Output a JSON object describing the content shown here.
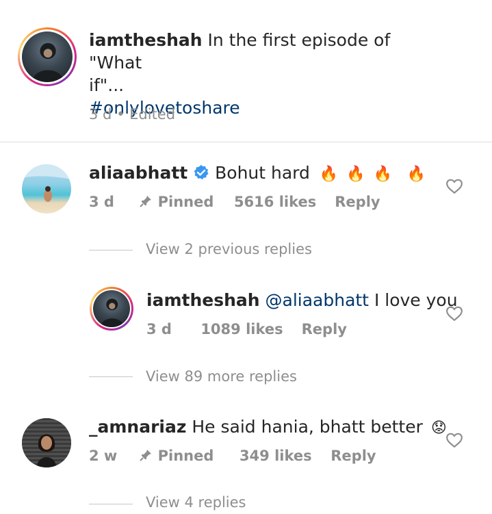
{
  "caption": {
    "username": "iamtheshah",
    "text_line1": "In the first episode of \"What",
    "text_line2": "if\"...",
    "hashtag": "#onlylovetoshare",
    "time": "3 d",
    "separator": "•",
    "edited": "Edited"
  },
  "comments": [
    {
      "username": "aliaabhatt",
      "verified": true,
      "text": "Bohut hard",
      "emojis": [
        "🔥",
        "🔥",
        "🔥",
        "🔥"
      ],
      "time": "3 d",
      "pinned": "Pinned",
      "likes": "5616 likes",
      "reply": "Reply",
      "view_replies": "View 2 previous replies",
      "replies": [
        {
          "username": "iamtheshah",
          "mention": "@aliaabhatt",
          "text": "I love you",
          "time": "3 d",
          "likes": "1089 likes",
          "reply": "Reply"
        }
      ],
      "view_more": "View 89 more replies"
    },
    {
      "username": "_amnariaz",
      "text": "He said hania, bhatt better",
      "emoji": "😟",
      "time": "2 w",
      "pinned": "Pinned",
      "likes": "349 likes",
      "reply": "Reply",
      "view_replies": "View 4 replies"
    }
  ],
  "colors": {
    "primary_text": "#262626",
    "secondary_text": "#8e8e8e",
    "link": "#00376b",
    "verified": "#3897f0"
  }
}
